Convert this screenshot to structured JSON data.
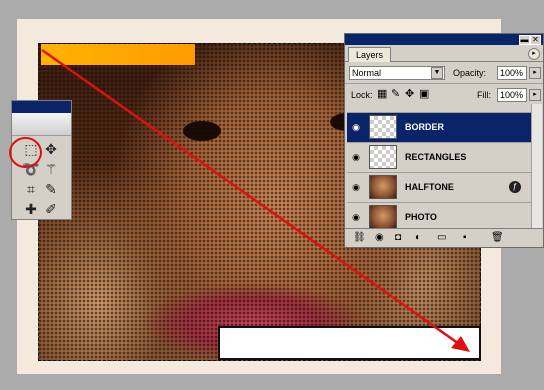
{
  "layers_panel": {
    "tab_label": "Layers",
    "blend_mode": "Normal",
    "opacity_label": "Opacity:",
    "opacity_value": "100%",
    "lock_label": "Lock:",
    "fill_label": "Fill:",
    "fill_value": "100%",
    "layers": [
      {
        "name": "BORDER",
        "selected": true,
        "thumb": "transparent"
      },
      {
        "name": "RECTANGLES",
        "selected": false,
        "thumb": "transparent"
      },
      {
        "name": "HALFTONE",
        "selected": false,
        "thumb": "photo",
        "has_effects": true
      },
      {
        "name": "PHOTO",
        "selected": false,
        "thumb": "photo"
      }
    ]
  },
  "colors": {
    "accent_orange": "#ff9a00",
    "selection_blue": "#0a246a",
    "annotation_red": "#e01010"
  }
}
